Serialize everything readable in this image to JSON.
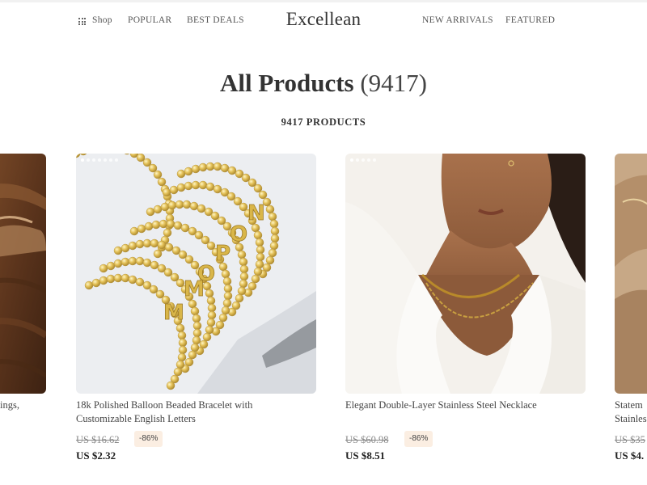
{
  "header": {
    "nav_left": [
      {
        "label": "Shop"
      },
      {
        "label": "POPULAR"
      },
      {
        "label": "BEST DEALS"
      }
    ],
    "brand": "Excellean",
    "nav_right": [
      {
        "label": "NEW ARRIVALS"
      },
      {
        "label": "FEATURED"
      }
    ]
  },
  "page": {
    "title": "All Products",
    "title_count": "(9417)",
    "subtitle": "9417 PRODUCTS"
  },
  "products": [
    {
      "name": "ings,",
      "old_price": "",
      "price": "",
      "discount": ""
    },
    {
      "name": "18k Polished Balloon Beaded Bracelet with Customizable English Letters",
      "old_price": "US $16.62",
      "discount": "-86%",
      "price": "US $2.32"
    },
    {
      "name": "Elegant Double-Layer Stainless Steel Necklace",
      "old_price": "US $60.98",
      "discount": "-86%",
      "price": "US $8.51"
    },
    {
      "name": "Statem Stainles",
      "old_price": "US $35",
      "discount": "",
      "price": "US $4."
    }
  ],
  "colors": {
    "badge_bg": "#fbeee2",
    "text": "#333333"
  }
}
